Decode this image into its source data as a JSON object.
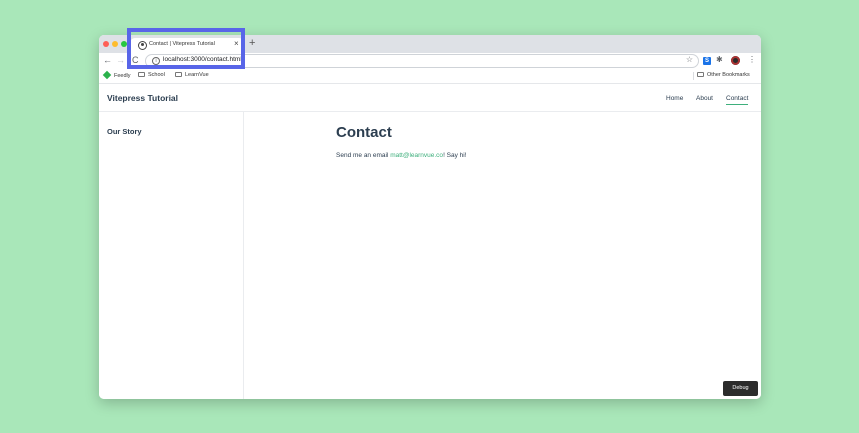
{
  "browser": {
    "tab": {
      "title": "Contact | Vitepress Tutorial",
      "close_glyph": "×",
      "favicon": "globe-icon"
    },
    "new_tab_glyph": "+",
    "toolbar": {
      "back_glyph": "←",
      "forward_glyph": "→",
      "reload_glyph": "C",
      "url": "localhost:3000/contact.html",
      "info_glyph": "i",
      "star_glyph": "☆",
      "extension_s_label": "S",
      "puzzle_glyph": "✱",
      "menu_glyph": "⋮"
    },
    "bookmarks": {
      "items": [
        {
          "label": "Feedly",
          "icon": "feedly-icon"
        },
        {
          "label": "School",
          "icon": "folder-icon"
        },
        {
          "label": "LearnVue",
          "icon": "folder-icon"
        }
      ],
      "other": "Other Bookmarks"
    }
  },
  "site": {
    "title": "Vitepress Tutorial",
    "nav": [
      "Home",
      "About",
      "Contact"
    ],
    "active_nav": "Contact",
    "accent_color": "#3eaf7c"
  },
  "sidebar": {
    "heading": "Our Story"
  },
  "content": {
    "title": "Contact",
    "text_before": "Send me an email ",
    "email": "matt@learnvue.co",
    "text_after": "! Say hi!"
  },
  "debug_label": "Debug",
  "highlight_color": "#5865e8"
}
